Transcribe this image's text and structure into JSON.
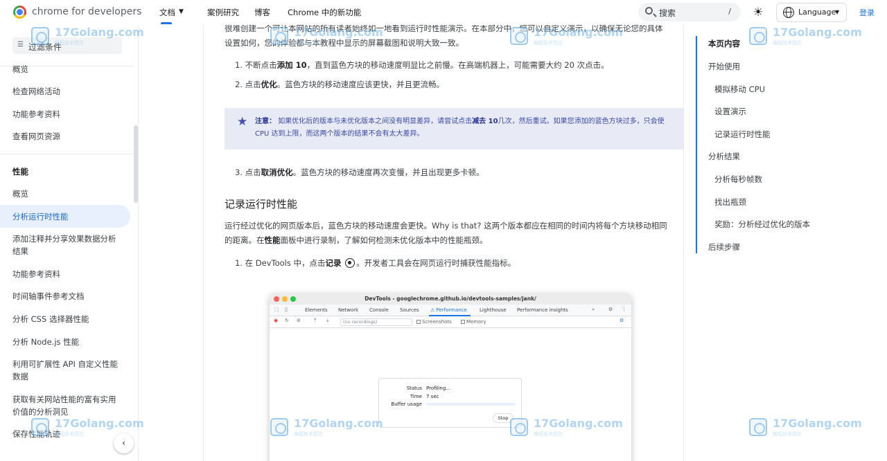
{
  "topbar": {
    "brand": "chrome for developers",
    "nav": {
      "docs": "文档",
      "cases": "案例研究",
      "blog": "博客",
      "whats_new": "Chrome 中的新功能"
    },
    "search_label": "搜索",
    "search_shortcut": "/",
    "language": "Language",
    "login": "登录"
  },
  "sidebar": {
    "filter": "过滤条件",
    "items": [
      {
        "label": "概览"
      },
      {
        "label": "检查网络活动"
      },
      {
        "label": "功能参考资料"
      },
      {
        "label": "查看网页资源"
      }
    ],
    "section_heading": "性能",
    "section_items": [
      {
        "label": "概览"
      },
      {
        "label": "分析运行时性能"
      },
      {
        "label": "添加注释并分享效果数据分析结果"
      },
      {
        "label": "功能参考资料"
      },
      {
        "label": "时间轴事件参考文档"
      },
      {
        "label": "分析 CSS 选择器性能"
      },
      {
        "label": "分析 Node.js 性能"
      },
      {
        "label": "利用可扩展性 API 自定义性能数据"
      },
      {
        "label": "获取有关网站性能的富有实用价值的分析洞见"
      },
      {
        "label": "保存性能轨迹"
      }
    ]
  },
  "article": {
    "intro": "很难创建一个可让本网站的所有读者始终如一地看到运行时性能演示。在本部分中，您可以自定义演示，以确保无论您的具体设置如何，您的体验都与本教程中显示的屏幕截图和说明大致一致。",
    "step1_pre": "不断点击",
    "step1_bold": "添加 10",
    "step1_post": "，直到蓝色方块的移动速度明显比之前慢。在高端机器上，可能需要大约 20 次点击。",
    "step2_pre": "点击",
    "step2_bold": "优化",
    "step2_post": "。蓝色方块的移动速度应该更快，并且更流畅。",
    "note_label": "注意：",
    "note_pre": "如果优化后的版本与未优化版本之间没有明显差异，请尝试点击",
    "note_bold": "减去 10",
    "note_post": "几次，然后重试。如果您添加的蓝色方块过多，只会使 CPU 达到上限，而这两个版本的结果不会有太大差异。",
    "step3_num": "3.",
    "step3_pre": "点击",
    "step3_bold": "取消优化",
    "step3_post": "。蓝色方块的移动速度再次变慢，并且出现更多卡顿。",
    "h2": "记录运行时性能",
    "p2_pre": "运行经过优化的网页版本后，蓝色方块的移动速度会更快。Why is that? 这两个版本都应在相同的时间内将每个方块移动相同的距离。在",
    "p2_bold": "性能",
    "p2_post": "面板中进行录制，了解如何检测未优化版本中的性能瓶颈。",
    "step_rec_pre": "在 DevTools 中，点击",
    "step_rec_bold": "记录",
    "step_rec_post": "。开发者工具会在网页运行时捕获性能指标。"
  },
  "devtools": {
    "title": "DevTools - googlechrome.github.io/devtools-samples/jank/",
    "tabs": [
      "Elements",
      "Network",
      "Console",
      "Sources",
      "Performance",
      "Lighthouse",
      "Performance insights"
    ],
    "active_tab": "Performance",
    "recordings": "(no recordings)",
    "screenshots": "Screenshots",
    "memory": "Memory",
    "status_label": "Status",
    "status_value": "Profiling…",
    "time_label": "Time",
    "time_value": "7 sec",
    "buffer_label": "Buffer usage",
    "stop": "Stop"
  },
  "toc": {
    "title": "本页内容",
    "items": [
      {
        "label": "开始使用"
      },
      {
        "label": "模拟移动 CPU"
      },
      {
        "label": "设置演示"
      },
      {
        "label": "记录运行时性能"
      },
      {
        "label": "分析结果"
      },
      {
        "label": "分析每秒帧数"
      },
      {
        "label": "找出瓶颈"
      },
      {
        "label": "奖励：分析经过优化的版本"
      },
      {
        "label": "后续步骤"
      }
    ]
  },
  "watermark": {
    "text": "17Golang.com",
    "sub": "编程技术图文"
  },
  "colors": {
    "accent": "#1a73e8",
    "note_bg": "#e8eaf6",
    "active_bg": "#e8f0fe"
  }
}
